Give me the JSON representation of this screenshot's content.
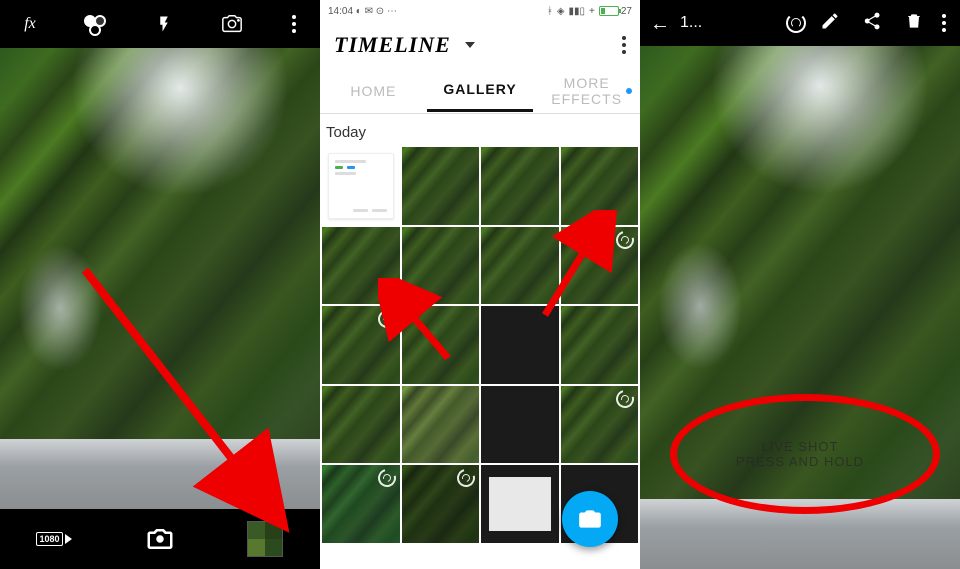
{
  "left": {
    "top_icons": [
      "fx",
      "color-filters",
      "flash",
      "camera-flip",
      "more"
    ],
    "bottom": {
      "resolution": "1080",
      "shutter": "camera",
      "thumb": "gallery-thumb"
    }
  },
  "middle": {
    "status": {
      "time": "14:04",
      "battery": "27"
    },
    "title": "TIMELINE",
    "tabs": {
      "home": "HOME",
      "gallery": "GALLERY",
      "more": "MORE EFFECTS"
    },
    "section": "Today",
    "fab": "camera"
  },
  "right": {
    "title": "1...",
    "top_icons": [
      "back",
      "live-spiral",
      "edit",
      "share",
      "delete",
      "more"
    ],
    "hint_line1": "LIVE SHOT",
    "hint_line2": "PRESS AND HOLD"
  }
}
